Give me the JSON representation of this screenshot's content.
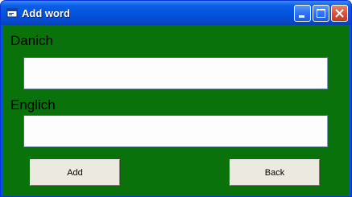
{
  "window": {
    "title": "Add word",
    "icon": "app-window-icon",
    "controls": [
      "minimize-icon",
      "maximize-icon",
      "close-icon"
    ]
  },
  "form": {
    "danish_label": "Danich",
    "danish_value": "",
    "english_label": "Englich",
    "english_value": ""
  },
  "buttons": {
    "add_label": "Add",
    "back_label": "Back"
  },
  "colors": {
    "client_background": "#0a720a",
    "titlebar": "#0454dc",
    "button_face": "#eceae0"
  }
}
